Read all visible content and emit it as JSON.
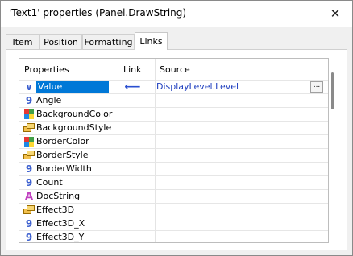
{
  "window": {
    "title": "'Text1' properties (Panel.DrawString)",
    "close_glyph": "✕"
  },
  "tabs": [
    {
      "label": "Item",
      "active": false
    },
    {
      "label": "Position",
      "active": false
    },
    {
      "label": "Formatting",
      "active": false
    },
    {
      "label": "Links",
      "active": true
    }
  ],
  "grid": {
    "headers": {
      "properties": "Properties",
      "link": "Link",
      "source": "Source"
    },
    "rows": [
      {
        "icon": "variable-icon",
        "glyph": "∨",
        "color": "#3b5fcf",
        "name": "Value",
        "selected": true,
        "link": "⟵",
        "source": "DisplayLevel.Level",
        "has_browse": true,
        "browse_label": "..."
      },
      {
        "icon": "number-icon",
        "glyph": "9",
        "color": "#3b5fcf",
        "name": "Angle"
      },
      {
        "icon": "color-icon",
        "glyph": "",
        "color": "",
        "name": "BackgroundColor"
      },
      {
        "icon": "style-icon",
        "glyph": "",
        "color": "",
        "name": "BackgroundStyle"
      },
      {
        "icon": "color-icon",
        "glyph": "",
        "color": "",
        "name": "BorderColor"
      },
      {
        "icon": "style-icon",
        "glyph": "",
        "color": "",
        "name": "BorderStyle"
      },
      {
        "icon": "number-icon",
        "glyph": "9",
        "color": "#3b5fcf",
        "name": "BorderWidth"
      },
      {
        "icon": "number-icon",
        "glyph": "9",
        "color": "#3b5fcf",
        "name": "Count"
      },
      {
        "icon": "string-icon",
        "glyph": "A",
        "color": "#c040c0",
        "name": "DocString"
      },
      {
        "icon": "style-icon",
        "glyph": "",
        "color": "",
        "name": "Effect3D"
      },
      {
        "icon": "number-icon",
        "glyph": "9",
        "color": "#3b5fcf",
        "name": "Effect3D_X"
      },
      {
        "icon": "number-icon",
        "glyph": "9",
        "color": "#3b5fcf",
        "name": "Effect3D_Y"
      }
    ]
  }
}
